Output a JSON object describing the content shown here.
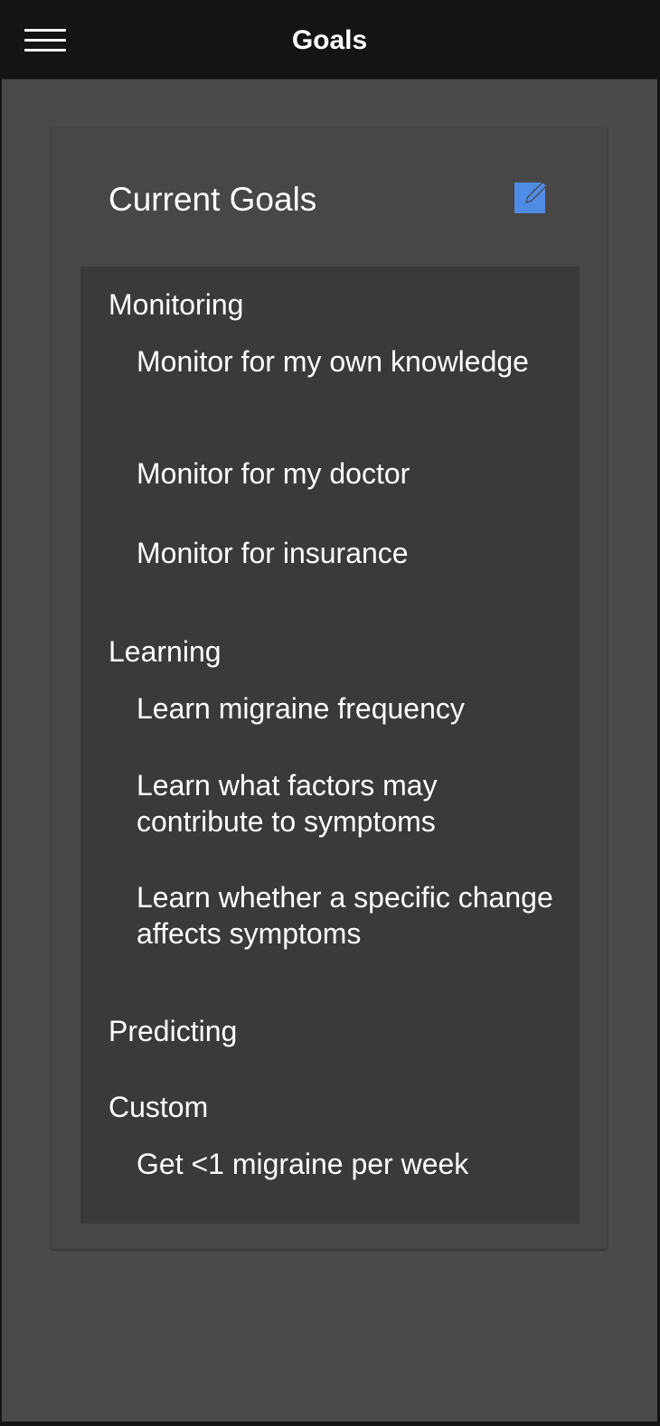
{
  "header": {
    "title": "Goals"
  },
  "card": {
    "title": "Current Goals"
  },
  "categories": [
    {
      "label": "Monitoring",
      "items": [
        "Monitor for my own knowledge",
        "Monitor for my doctor",
        "Monitor for insurance"
      ]
    },
    {
      "label": "Learning",
      "items": [
        "Learn migraine frequency",
        "Learn what factors may contribute to symptoms",
        "Learn whether a specific change affects symptoms"
      ]
    },
    {
      "label": "Predicting",
      "items": []
    },
    {
      "label": "Custom",
      "items": [
        "Get <1 migraine per week"
      ]
    }
  ],
  "icons": {
    "menu": "hamburger-menu-icon",
    "edit": "edit-pencil-icon"
  },
  "colors": {
    "topbar": "#141414",
    "background": "#4a4a4a",
    "card": "#474747",
    "list": "#3a3a3a",
    "accent": "#4f8ce6",
    "text": "#ffffff"
  }
}
